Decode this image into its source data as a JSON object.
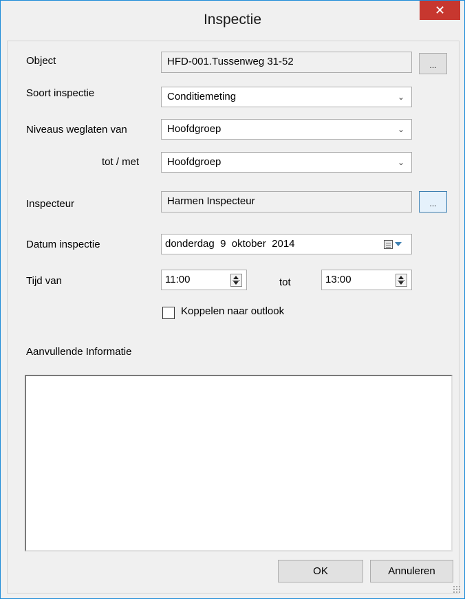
{
  "window": {
    "title": "Inspectie",
    "close_glyph": "✕"
  },
  "fields": {
    "object": {
      "label": "Object",
      "value": "HFD-001.Tussenweg 31-52",
      "button": "..."
    },
    "soort_inspectie": {
      "label": "Soort inspectie",
      "value": "Conditiemeting"
    },
    "niveaus_weglaten_van": {
      "label": "Niveaus weglaten van",
      "value": "Hoofdgroep"
    },
    "tot_met": {
      "label": "tot / met",
      "value": "Hoofdgroep"
    },
    "inspecteur": {
      "label": "Inspecteur",
      "value": "Harmen Inspecteur",
      "button": "..."
    },
    "datum_inspectie": {
      "label": "Datum inspectie",
      "weekday": "donderdag",
      "day": "9",
      "month": "oktober",
      "year": "2014"
    },
    "tijd": {
      "label_van": "Tijd van",
      "van": "11:00",
      "label_tot": "tot",
      "tot": "13:00"
    },
    "koppelen": {
      "label": "Koppelen naar outlook",
      "checked": false
    },
    "aanvullende_informatie": {
      "label": "Aanvullende Informatie",
      "value": ""
    }
  },
  "buttons": {
    "ok": "OK",
    "cancel": "Annuleren"
  },
  "icons": {
    "dropdown": "chevron-down-icon",
    "calendar": "calendar-icon",
    "spinner": "spinner-icon",
    "close": "close-icon"
  },
  "colors": {
    "close_button": "#c7372f",
    "window_border": "#1c8bd8",
    "focus_accent": "#3c7fb1"
  }
}
